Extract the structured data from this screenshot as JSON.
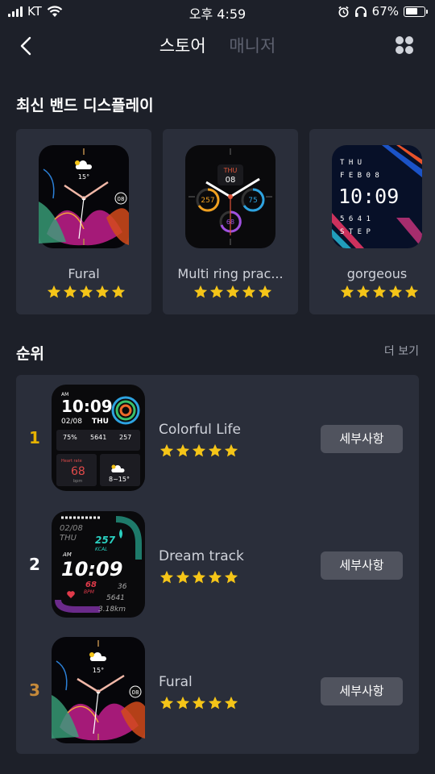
{
  "status_bar": {
    "carrier": "KT",
    "time": "오후 4:59",
    "battery": "67%",
    "battery_level": 0.67
  },
  "header": {
    "tabs": [
      {
        "label": "스토어",
        "active": true
      },
      {
        "label": "매니저",
        "active": false
      }
    ],
    "icons": {
      "back": "chevron-left-icon",
      "menu": "grid-icon"
    }
  },
  "featured": {
    "title": "최신 밴드 디스플레이",
    "items": [
      {
        "name": "Fural",
        "rating": 5,
        "face": {
          "date": "08",
          "temp": "15°"
        }
      },
      {
        "name": "Multi ring prac...",
        "rating": 5,
        "face": {
          "day": "THU",
          "date": "08",
          "left_value": "257",
          "right_value": "75",
          "bottom_value": "68"
        }
      },
      {
        "name": "gorgeous",
        "rating": 5,
        "face": {
          "row1": "T H U",
          "row2": "F E B 0 8",
          "time": "10:09",
          "row3": "5 6 4 1",
          "row4": "S T E P"
        }
      }
    ]
  },
  "ranking": {
    "title": "순위",
    "more_label": "더 보기",
    "detail_label": "세부사항",
    "items": [
      {
        "rank": "1",
        "rank_color": "#e6b200",
        "name": "Colorful Life",
        "rating": 5,
        "face": {
          "ampm": "AM",
          "time": "10:09",
          "date": "02/08",
          "day": "THU",
          "stat1": "75%",
          "stat2": "5641",
          "stat3": "257",
          "heart_label": "Heart rate",
          "heart_value": "68",
          "heart_unit": "bpm",
          "weather": "8~15°"
        }
      },
      {
        "rank": "2",
        "rank_color": "#ffffff",
        "name": "Dream track",
        "rating": 5,
        "face": {
          "date": "02/08",
          "day": "THU",
          "kcal": "257",
          "kcal_unit": "KCAL",
          "ampm": "AM",
          "time": "10:09",
          "bpm": "68",
          "bpm_unit": "BPM",
          "v1": "36",
          "v2": "5641",
          "v3": "3.18km"
        }
      },
      {
        "rank": "3",
        "rank_color": "#c68a3a",
        "name": "Fural",
        "rating": 5,
        "face": {
          "date": "08",
          "temp": "15°"
        }
      }
    ]
  },
  "colors": {
    "background": "#1d2029",
    "card": "#2a2e3a",
    "star": "#f5c518",
    "button": "#50535e"
  }
}
